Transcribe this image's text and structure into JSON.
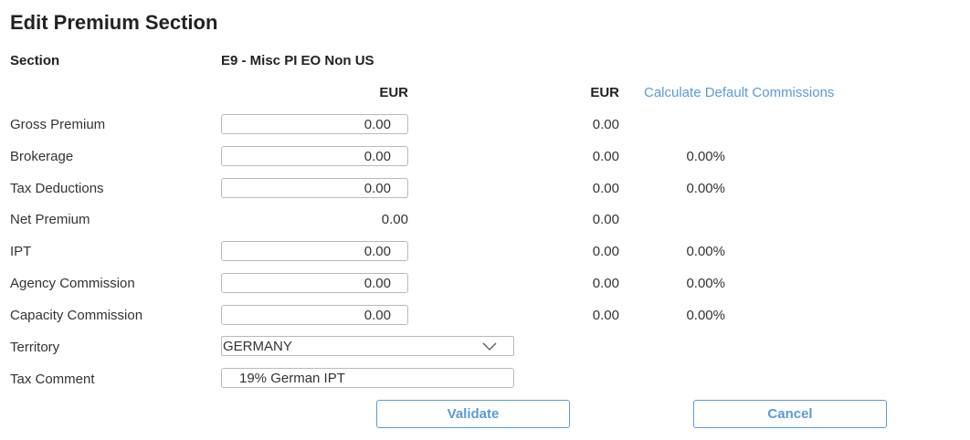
{
  "title": "Edit Premium Section",
  "section": {
    "label": "Section",
    "value": "E9 - Misc PI EO Non US"
  },
  "currency": {
    "col1": "EUR",
    "col2": "EUR"
  },
  "calc_link": "Calculate Default Commissions",
  "rows": [
    {
      "label": "Gross Premium",
      "input": "0.00",
      "eur": "0.00",
      "pct": ""
    },
    {
      "label": "Brokerage",
      "input": "0.00",
      "eur": "0.00",
      "pct": "0.00%"
    },
    {
      "label": "Tax Deductions",
      "input": "0.00",
      "eur": "0.00",
      "pct": "0.00%"
    },
    {
      "label": "Net Premium",
      "value": "0.00",
      "eur": "0.00",
      "pct": ""
    },
    {
      "label": "IPT",
      "input": "0.00",
      "eur": "0.00",
      "pct": "0.00%"
    },
    {
      "label": "Agency Commission",
      "input": "0.00",
      "eur": "0.00",
      "pct": "0.00%"
    },
    {
      "label": "Capacity Commission",
      "input": "0.00",
      "eur": "0.00",
      "pct": "0.00%"
    }
  ],
  "territory": {
    "label": "Territory",
    "value": "GERMANY",
    "icon": "chevron-down-icon"
  },
  "tax_comment": {
    "label": "Tax Comment",
    "value": "19% German IPT"
  },
  "buttons": {
    "validate": "Validate",
    "cancel": "Cancel"
  },
  "colors": {
    "accent": "#5b9bd5",
    "border": "#b9b9b9",
    "text": "#333333"
  }
}
